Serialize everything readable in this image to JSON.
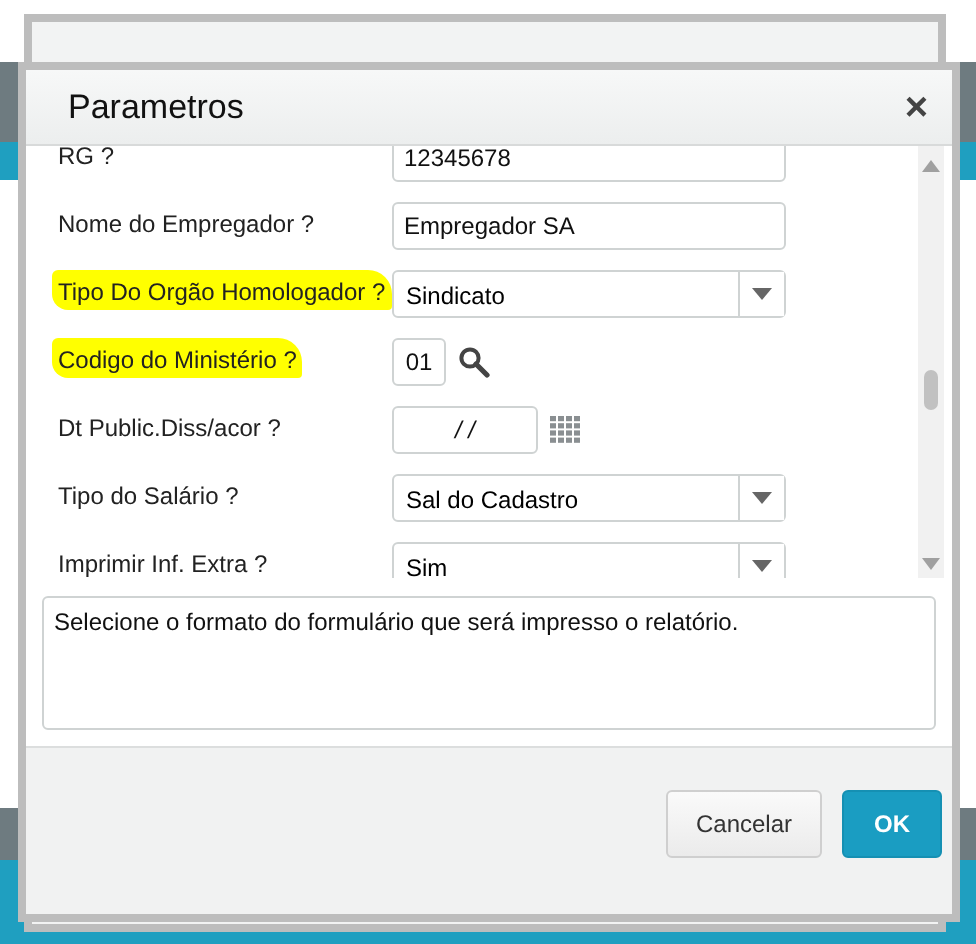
{
  "dialog": {
    "title": "Parametros",
    "close": "×"
  },
  "fields": [
    {
      "label": "RG ?",
      "kind": "text",
      "value": "12345678",
      "highlighted": false
    },
    {
      "label": "Nome do Empregador ?",
      "kind": "text",
      "value": "Empregador SA",
      "highlighted": false
    },
    {
      "label": "Tipo Do Orgão Homologador ?",
      "kind": "select",
      "value": "Sindicato",
      "highlighted": true
    },
    {
      "label": "Codigo do Ministério ?",
      "kind": "lookup",
      "value": "01",
      "highlighted": true
    },
    {
      "label": "Dt Public.Diss/acor ?",
      "kind": "date",
      "value": "/ /",
      "highlighted": false
    },
    {
      "label": "Tipo do Salário ?",
      "kind": "select",
      "value": "Sal do Cadastro",
      "highlighted": false
    },
    {
      "label": "Imprimir Inf. Extra ?",
      "kind": "select",
      "value": "Sim",
      "highlighted": false
    }
  ],
  "description": "Selecione o formato do formulário que será impresso o relatório.",
  "buttons": [
    {
      "label": "Cancelar",
      "kind": "secondary"
    },
    {
      "label": "OK",
      "kind": "primary"
    }
  ]
}
